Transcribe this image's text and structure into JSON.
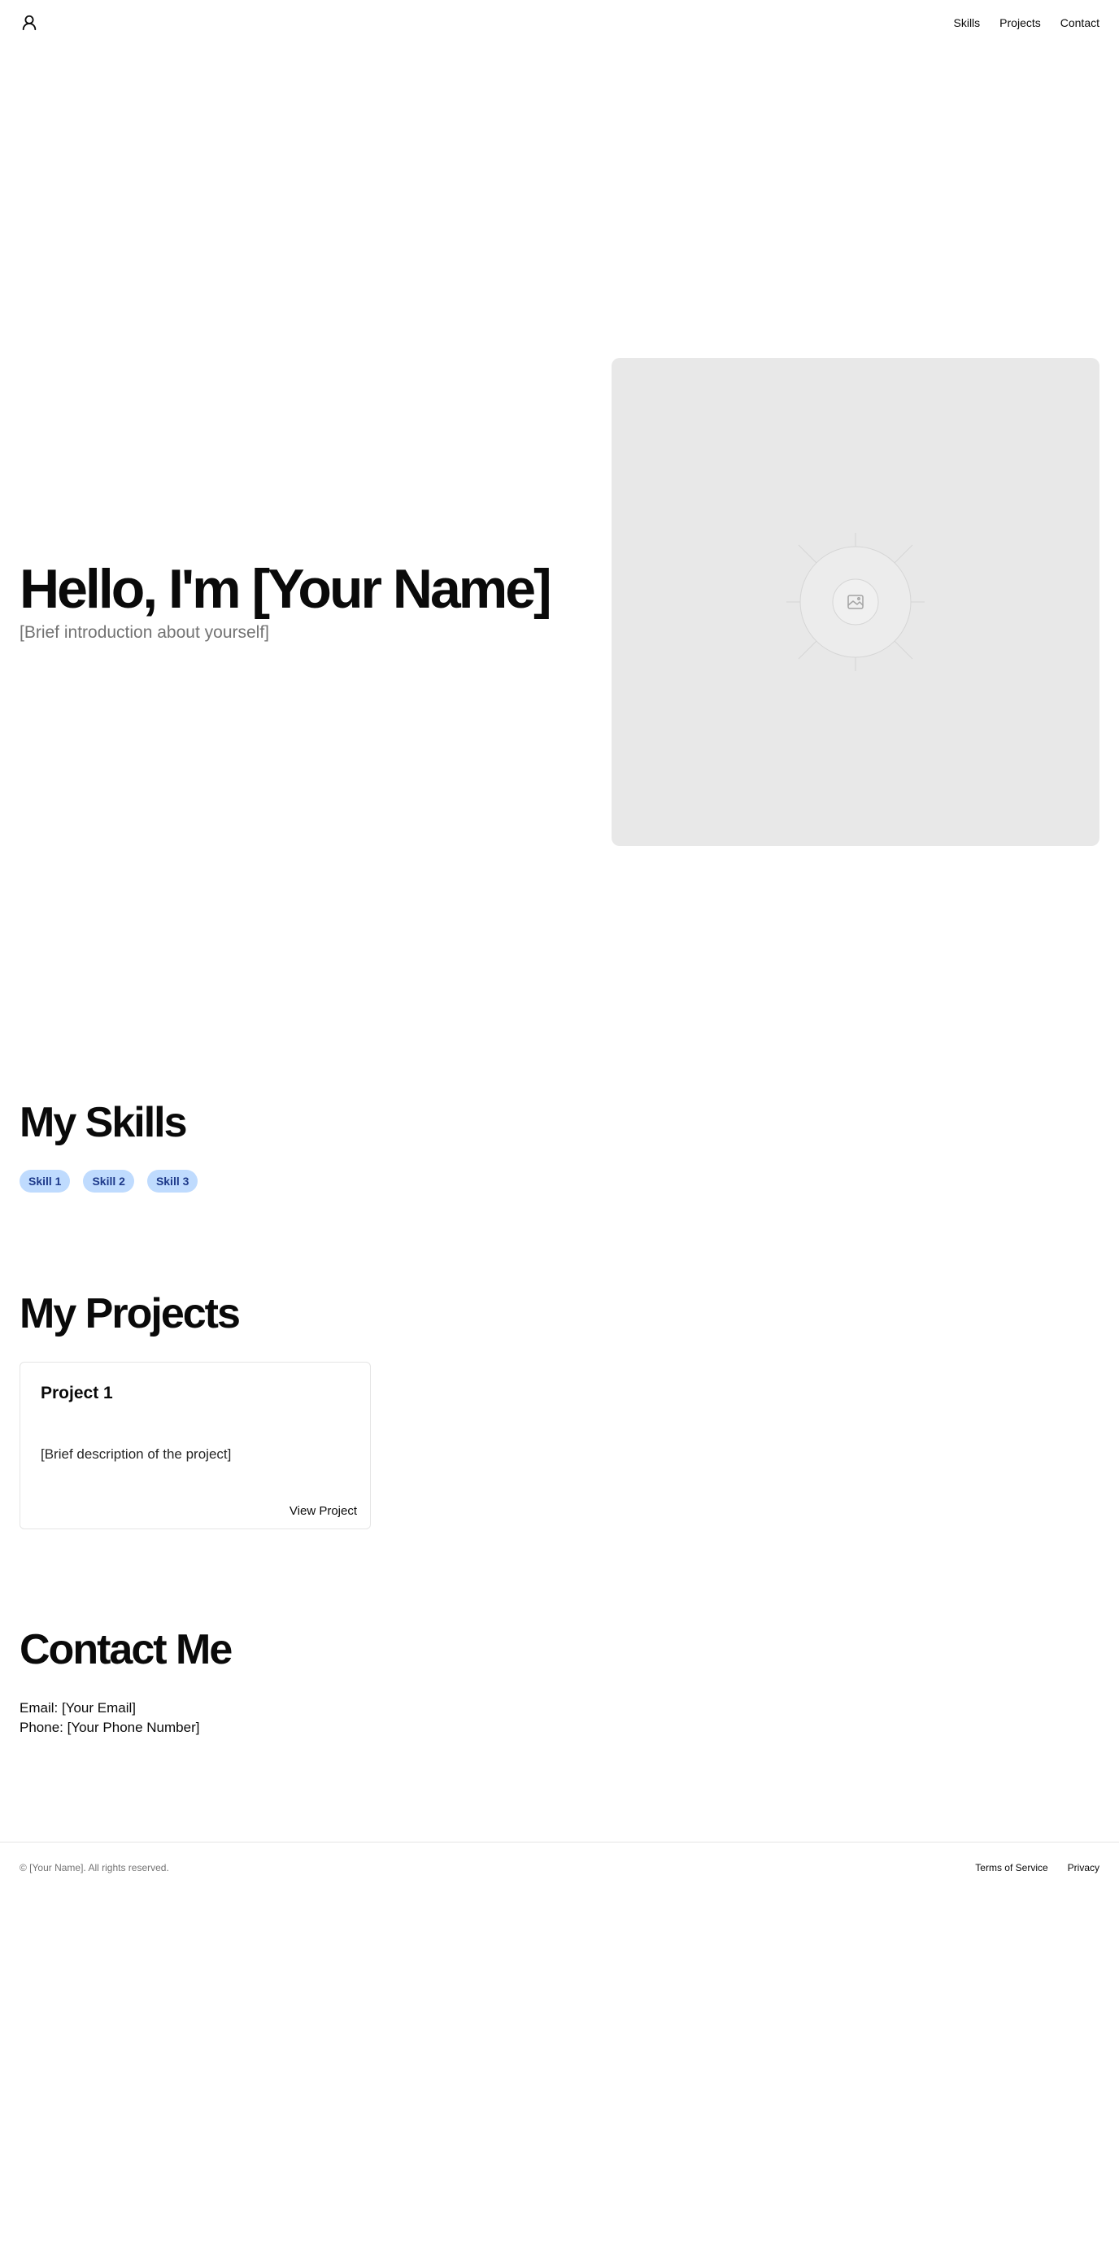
{
  "header": {
    "logo_icon": "user-icon",
    "nav": [
      {
        "label": "Skills"
      },
      {
        "label": "Projects"
      },
      {
        "label": "Contact"
      }
    ]
  },
  "hero": {
    "title": "Hello, I'm [Your Name]",
    "subtitle": "[Brief introduction about yourself]",
    "image_icon": "image-placeholder-icon",
    "image_bg": "#e8e8e8"
  },
  "skills": {
    "title": "My Skills",
    "items": [
      "Skill 1",
      "Skill 2",
      "Skill 3"
    ],
    "badge_bg": "#bfdbfe",
    "badge_text": "#1e3a8a"
  },
  "projects": {
    "title": "My Projects",
    "items": [
      {
        "title": "Project 1",
        "description": "[Brief description of the project]",
        "link_label": "View Project"
      }
    ]
  },
  "contact": {
    "title": "Contact Me",
    "email": "Email: [Your Email]",
    "phone": "Phone: [Your Phone Number]"
  },
  "footer": {
    "copyright": "© [Your Name]. All rights reserved.",
    "links": [
      {
        "label": "Terms of Service"
      },
      {
        "label": "Privacy"
      }
    ]
  }
}
